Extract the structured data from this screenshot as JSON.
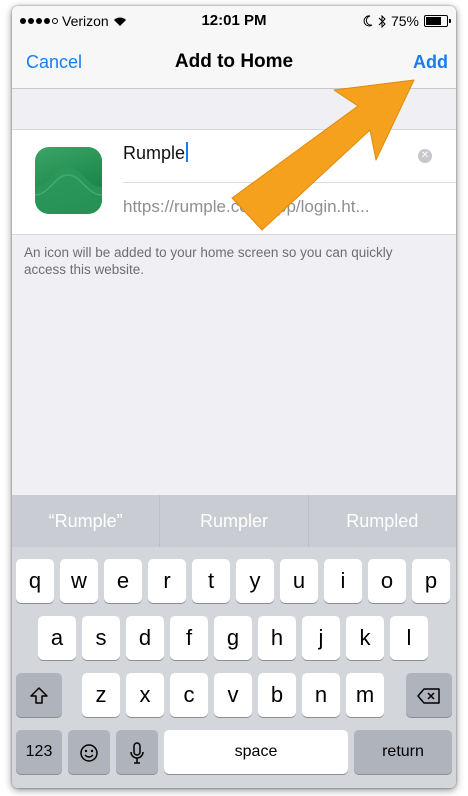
{
  "status_bar": {
    "carrier": "Verizon",
    "time": "12:01 PM",
    "battery": "75%",
    "battery_level": 0.75,
    "icons": [
      "signal-icon",
      "wifi-icon",
      "moon-icon",
      "bluetooth-icon",
      "battery-icon"
    ]
  },
  "nav": {
    "cancel": "Cancel",
    "title": "Add to Home",
    "add": "Add"
  },
  "form": {
    "name_value": "Rumple",
    "url_value": "https://rumple.com/app/login.ht...",
    "info": "An icon will be added to your home screen so you can quickly access this website."
  },
  "keyboard": {
    "suggestions": [
      "“Rumple”",
      "Rumpler",
      "Rumpled"
    ],
    "row1": [
      "q",
      "w",
      "e",
      "r",
      "t",
      "y",
      "u",
      "i",
      "o",
      "p"
    ],
    "row2": [
      "a",
      "s",
      "d",
      "f",
      "g",
      "h",
      "j",
      "k",
      "l"
    ],
    "row3": [
      "z",
      "x",
      "c",
      "v",
      "b",
      "n",
      "m"
    ],
    "numbers": "123",
    "space": "space",
    "return": "return"
  },
  "colors": {
    "accent": "#1a7cf5",
    "arrow": "#f5a11e",
    "app_icon": "#1e8a4d"
  }
}
